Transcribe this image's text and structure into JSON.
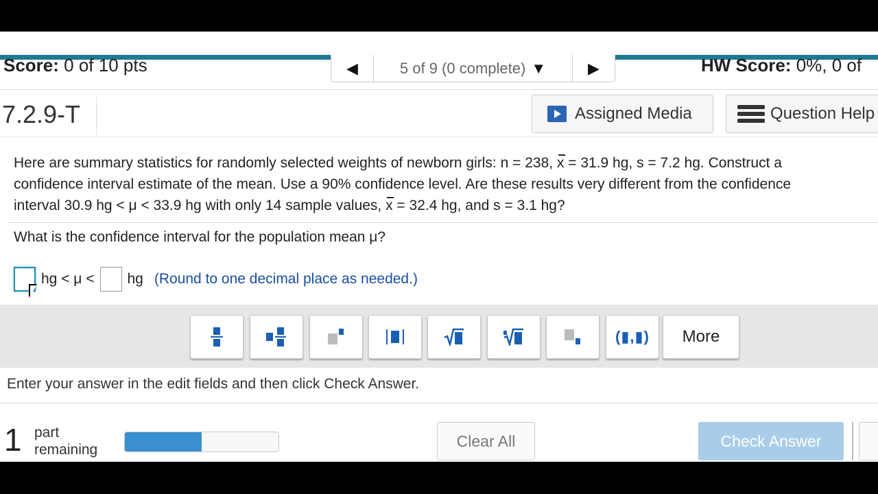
{
  "header": {
    "score_label": "Score:",
    "score_value": "0 of 10 pts",
    "nav_prev_icon": "triangle-left-icon",
    "nav_position": "5 of 9 (0 complete)",
    "nav_dropdown_icon": "triangle-down-icon",
    "nav_next_icon": "triangle-right-icon",
    "hw_score_label": "HW Score:",
    "hw_score_value": "0%, 0 of"
  },
  "question_bar": {
    "question_id": "7.2.9-T",
    "assigned_media_label": "Assigned Media",
    "question_help_label": "Question Help"
  },
  "question": {
    "line1_a": "Here are summary statistics for randomly selected weights of newborn girls: n = 238, ",
    "xbar_symbol": "x",
    "line1_b": " = 31.9 hg, s = 7.2 hg. Construct a",
    "line2": "confidence interval estimate of the mean. Use a 90% confidence level. Are these results very different from the confidence",
    "line3_a": "interval 30.9 hg < μ < 33.9 hg with only 14 sample values, ",
    "line3_b": " = 32.4 hg, and s = 3.1 hg?",
    "prompt": "What is the confidence interval for the population mean μ?"
  },
  "answer": {
    "middle_text": "hg < μ <",
    "unit": "hg",
    "hint": "(Round to one decimal place as needed.)"
  },
  "toolbar": {
    "tools": [
      "fraction",
      "mixed-number",
      "exponent",
      "absolute-value",
      "square-root",
      "nth-root",
      "subscript",
      "ordered-pair"
    ],
    "more_label": "More"
  },
  "instructions": "Enter your answer in the edit fields and then click Check Answer.",
  "footer": {
    "parts_remaining_count": "1",
    "parts_remaining_label_1": "part",
    "parts_remaining_label_2": "remaining",
    "progress_fraction": 0.5,
    "clear_all_label": "Clear All",
    "check_answer_label": "Check Answer"
  },
  "colors": {
    "accent_bar": "#1c7a94",
    "progress": "#3a8fd0",
    "check_button": "#a9cde8",
    "hint_text": "#1a4fa0"
  }
}
